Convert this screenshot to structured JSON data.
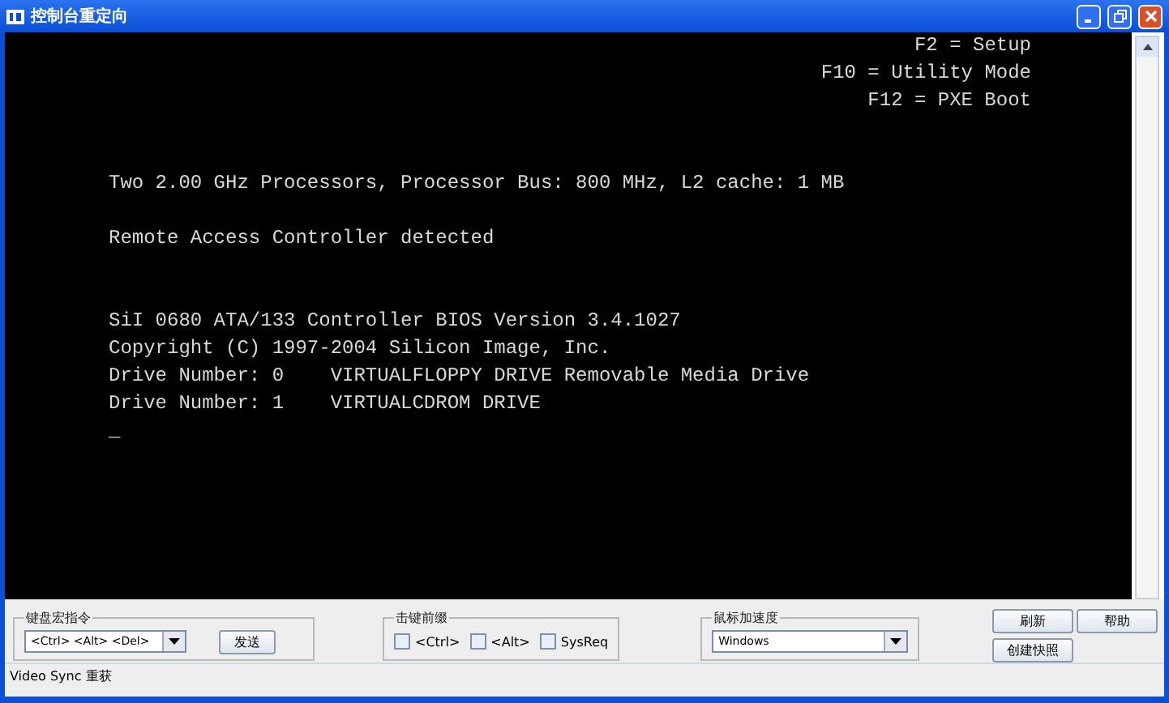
{
  "window": {
    "title": "控制台重定向"
  },
  "console": {
    "hotkeys": [
      "F2 = Setup",
      "F10 = Utility Mode",
      "F12 = PXE Boot"
    ],
    "blocks": [
      [
        "Two 2.00 GHz Processors, Processor Bus: 800 MHz, L2 cache: 1 MB"
      ],
      [
        "Remote Access Controller detected"
      ],
      [
        "SiI 0680 ATA/133 Controller BIOS Version 3.4.1027",
        "Copyright (C) 1997-2004 Silicon Image, Inc.",
        "Drive Number: 0    VIRTUALFLOPPY DRIVE Removable Media Drive",
        "Drive Number: 1    VIRTUALCDROM DRIVE"
      ]
    ],
    "cursor": "_"
  },
  "macro": {
    "title": "键盘宏指令",
    "value": "<Ctrl> <Alt> <Del>",
    "send": "发送"
  },
  "prefix": {
    "title": "击键前缀",
    "options": [
      {
        "label": "<Ctrl>",
        "checked": false
      },
      {
        "label": "<Alt>",
        "checked": false
      },
      {
        "label": "SysReq",
        "checked": false
      }
    ]
  },
  "mouse": {
    "title": "鼠标加速度",
    "value": "Windows"
  },
  "buttons": [
    "刷新",
    "帮助",
    "创建快照"
  ],
  "status_bar": "Video Sync 重获"
}
